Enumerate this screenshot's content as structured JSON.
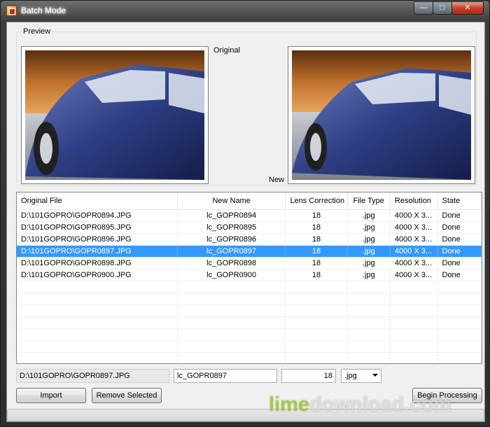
{
  "window": {
    "title": "Batch Mode",
    "close_glyph": "✕",
    "max_glyph": "□",
    "min_glyph": "—"
  },
  "preview": {
    "legend": "Preview",
    "original_label": "Original",
    "new_label": "New"
  },
  "table": {
    "columns": [
      "Original File",
      "New Name",
      "Lens Correction",
      "File Type",
      "Resolution",
      "State"
    ],
    "rows": [
      {
        "file": "D:\\101GOPRO\\GOPR0894.JPG",
        "new": "lc_GOPR0894",
        "lens": "18",
        "type": ".jpg",
        "res": "4000 X 3...",
        "state": "Done"
      },
      {
        "file": "D:\\101GOPRO\\GOPR0895.JPG",
        "new": "lc_GOPR0895",
        "lens": "18",
        "type": ".jpg",
        "res": "4000 X 3...",
        "state": "Done"
      },
      {
        "file": "D:\\101GOPRO\\GOPR0896.JPG",
        "new": "lc_GOPR0896",
        "lens": "18",
        "type": ".jpg",
        "res": "4000 X 3...",
        "state": "Done"
      },
      {
        "file": "D:\\101GOPRO\\GOPR0897.JPG",
        "new": "lc_GOPR0897",
        "lens": "18",
        "type": ".jpg",
        "res": "4000 X 3...",
        "state": "Done",
        "selected": true
      },
      {
        "file": "D:\\101GOPRO\\GOPR0898.JPG",
        "new": "lc_GOPR0898",
        "lens": "18",
        "type": ".jpg",
        "res": "4000 X 3...",
        "state": "Done"
      },
      {
        "file": "D:\\101GOPRO\\GOPR0900.JPG",
        "new": "lc_GOPR0900",
        "lens": "18",
        "type": ".jpg",
        "res": "4000 X 3...",
        "state": "Done"
      }
    ]
  },
  "edit": {
    "path": "D:\\101GOPRO\\GOPR0897.JPG",
    "new_name": "lc_GOPR0897",
    "lens": "18",
    "file_type": ".jpg"
  },
  "buttons": {
    "import": "Import",
    "remove": "Remove Selected",
    "begin": "Begin Processing"
  },
  "progress": {
    "value": 0
  },
  "watermark": {
    "part1": "lime",
    "part2": "download.com"
  },
  "colors": {
    "selection": "#3399ff",
    "progress": "#06b025"
  }
}
